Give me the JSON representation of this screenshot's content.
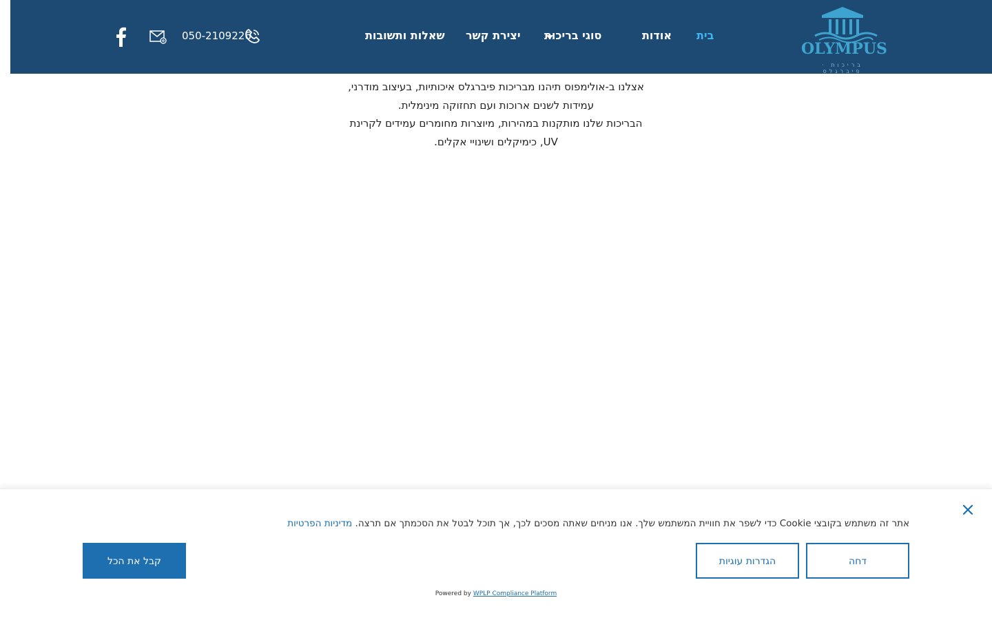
{
  "header": {
    "logo": {
      "word": "OLYMPUS",
      "subtitle": "בריכות · פיברגלס"
    },
    "nav": [
      {
        "label": "בית",
        "active": true
      },
      {
        "label": "אודות",
        "active": false
      },
      {
        "label": "סוגי בריכות",
        "active": false,
        "has_dropdown": true
      },
      {
        "label": "יצירת קשר",
        "active": false
      },
      {
        "label": "שאלות ותשובות",
        "active": false
      }
    ],
    "phone": "050-2109226",
    "icons": [
      "phone-icon",
      "mail-icon",
      "facebook-icon",
      "dropdown-caret-icon"
    ]
  },
  "main": {
    "intro_lines": [
      "אצלנו ב-אולימפוס תיהנו מבריכות פיברגלס איכותיות, בעיצוב מודרני,",
      "עמידות לשנים ארוכות ועם תחזוקה מינימלית.",
      "הבריכות שלנו מותקנות במהירות, מיוצרות מחומרים עמידים לקרינת",
      "UV, כימיקלים ושינויי אקלים."
    ]
  },
  "cookie_banner": {
    "message": "אתר זה משתמש בקובצי Cookie כדי לשפר את חוויית המשתמש שלך. אנו מניחים שאתה מסכים לכך, אך תוכל לבטל את הסכמתך אם תרצה.",
    "privacy_link": "מדיניות הפרטיות",
    "reject_label": "דחה",
    "settings_label": "הגדרות עוגיות",
    "accept_label": "קבל את הכל",
    "powered_by": "Powered by",
    "powered_link": "WPLP Compliance Platform"
  },
  "colors": {
    "header_bg": "#1c4a73",
    "nav_active": "#42b4f0",
    "accent": "#1e6fb0"
  }
}
